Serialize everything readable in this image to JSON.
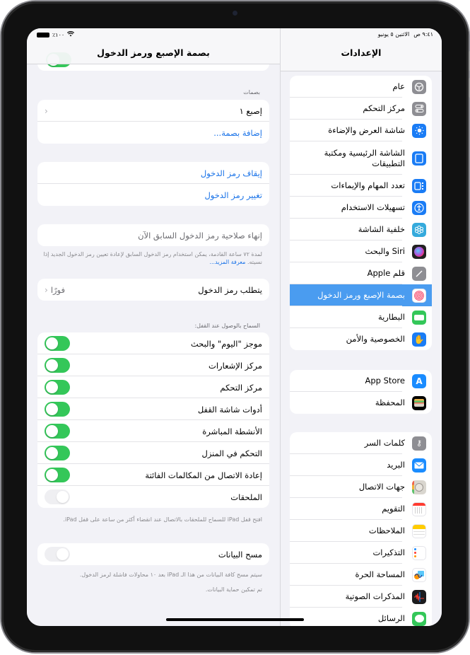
{
  "status_bar": {
    "time": "٩:٤١ ص",
    "date": "الاثنين ٥ يونيو",
    "battery": "٪١٠٠"
  },
  "sidebar": {
    "title": "الإعدادات",
    "groups": [
      [
        {
          "label": "عام",
          "icon": "gear-icon",
          "color": "#8e8e93"
        },
        {
          "label": "مركز التحكم",
          "icon": "toggles-icon",
          "color": "#8e8e93"
        },
        {
          "label": "شاشة العرض والإضاءة",
          "icon": "sun-icon",
          "color": "#1a7cf5"
        },
        {
          "label": "الشاشة الرئيسية ومكتبة التطبيقات",
          "icon": "home-screen-icon",
          "color": "#1a7cf5"
        },
        {
          "label": "تعدد المهام والإيماءات",
          "icon": "multitasking-icon",
          "color": "#1a7cf5"
        },
        {
          "label": "تسهيلات الاستخدام",
          "icon": "accessibility-icon",
          "color": "#1a7cf5"
        },
        {
          "label": "خلفية الشاشة",
          "icon": "wallpaper-icon",
          "color": "#35aadc"
        },
        {
          "label": "Siri والبحث",
          "icon": "siri-icon",
          "color": "#222"
        },
        {
          "label": "قلم Apple",
          "icon": "pencil-icon",
          "color": "#8e8e93"
        },
        {
          "label": "بصمة الإصبع ورمز الدخول",
          "icon": "fingerprint-icon",
          "color": "#ffffff",
          "selected": true
        },
        {
          "label": "البطارية",
          "icon": "battery-icon",
          "color": "#34c759"
        },
        {
          "label": "الخصوصية والأمن",
          "icon": "hand-icon",
          "color": "#1a7cf5"
        }
      ],
      [
        {
          "label": "App Store",
          "icon": "app-store-icon",
          "color": "#1a8cff"
        },
        {
          "label": "المحفظة",
          "icon": "wallet-icon",
          "color": "#000"
        }
      ],
      [
        {
          "label": "كلمات السر",
          "icon": "key-icon",
          "color": "#8e8e93"
        },
        {
          "label": "البريد",
          "icon": "mail-icon",
          "color": "#1a8cff"
        },
        {
          "label": "جهات الاتصال",
          "icon": "contacts-icon",
          "color": "#d9d6cf"
        },
        {
          "label": "التقويم",
          "icon": "calendar-icon",
          "color": "#ffffff"
        },
        {
          "label": "الملاحظات",
          "icon": "notes-icon",
          "color": "#ffffff"
        },
        {
          "label": "التذكيرات",
          "icon": "reminders-icon",
          "color": "#ffffff"
        },
        {
          "label": "المساحة الحرة",
          "icon": "freeform-icon",
          "color": "#ffffff"
        },
        {
          "label": "المذكرات الصوتية",
          "icon": "voice-memos-icon",
          "color": "#1c1c1e"
        },
        {
          "label": "الرسائل",
          "icon": "messages-icon",
          "color": "#34c759"
        }
      ]
    ]
  },
  "detail": {
    "title": "بصمة الإصبع ورمز الدخول",
    "fingerprints_label": "بصمات",
    "finger1": "إصبع ١",
    "add_fingerprint": "إضافة بصمة...",
    "turn_off_passcode": "إيقاف رمز الدخول",
    "change_passcode": "تغيير رمز الدخول",
    "expire_previous": "إنهاء صلاحية رمز الدخول السابق الآن",
    "expire_note": "لمدة ٧٢ ساعة القادمة، يمكن استخدام رمز الدخول السابق لإعادة تعيين رمز الدخول الجديد إذا نسيته.",
    "learn_more": "معرفة المزيد...",
    "require_passcode": "يتطلب رمز الدخول",
    "require_value": "فورًا",
    "allow_access_label": "السماح بالوصول عند القفل:",
    "lock_items": [
      {
        "label": "موجز \"اليوم\" والبحث",
        "on": true
      },
      {
        "label": "مركز الإشعارات",
        "on": true
      },
      {
        "label": "مركز التحكم",
        "on": true
      },
      {
        "label": "أدوات شاشة القفل",
        "on": true
      },
      {
        "label": "الأنشطة المباشرة",
        "on": true
      },
      {
        "label": "التحكم في المنزل",
        "on": true
      },
      {
        "label": "إعادة الاتصال من المكالمات الفائتة",
        "on": true
      },
      {
        "label": "الملحقات",
        "on": false
      }
    ],
    "accessories_note": "افتح قفل iPad للسماح للملحقات بالاتصال عند انقضاء أكثر من ساعة على قفل iPad.",
    "erase_data": "مسح البيانات",
    "erase_on": false,
    "erase_note": "سيتم مسح كافة البيانات من هذا الـ iPad بعد ١٠ محاولات فاشلة لرمز الدخول.",
    "protection_note": "تم تمكين حماية البيانات."
  }
}
